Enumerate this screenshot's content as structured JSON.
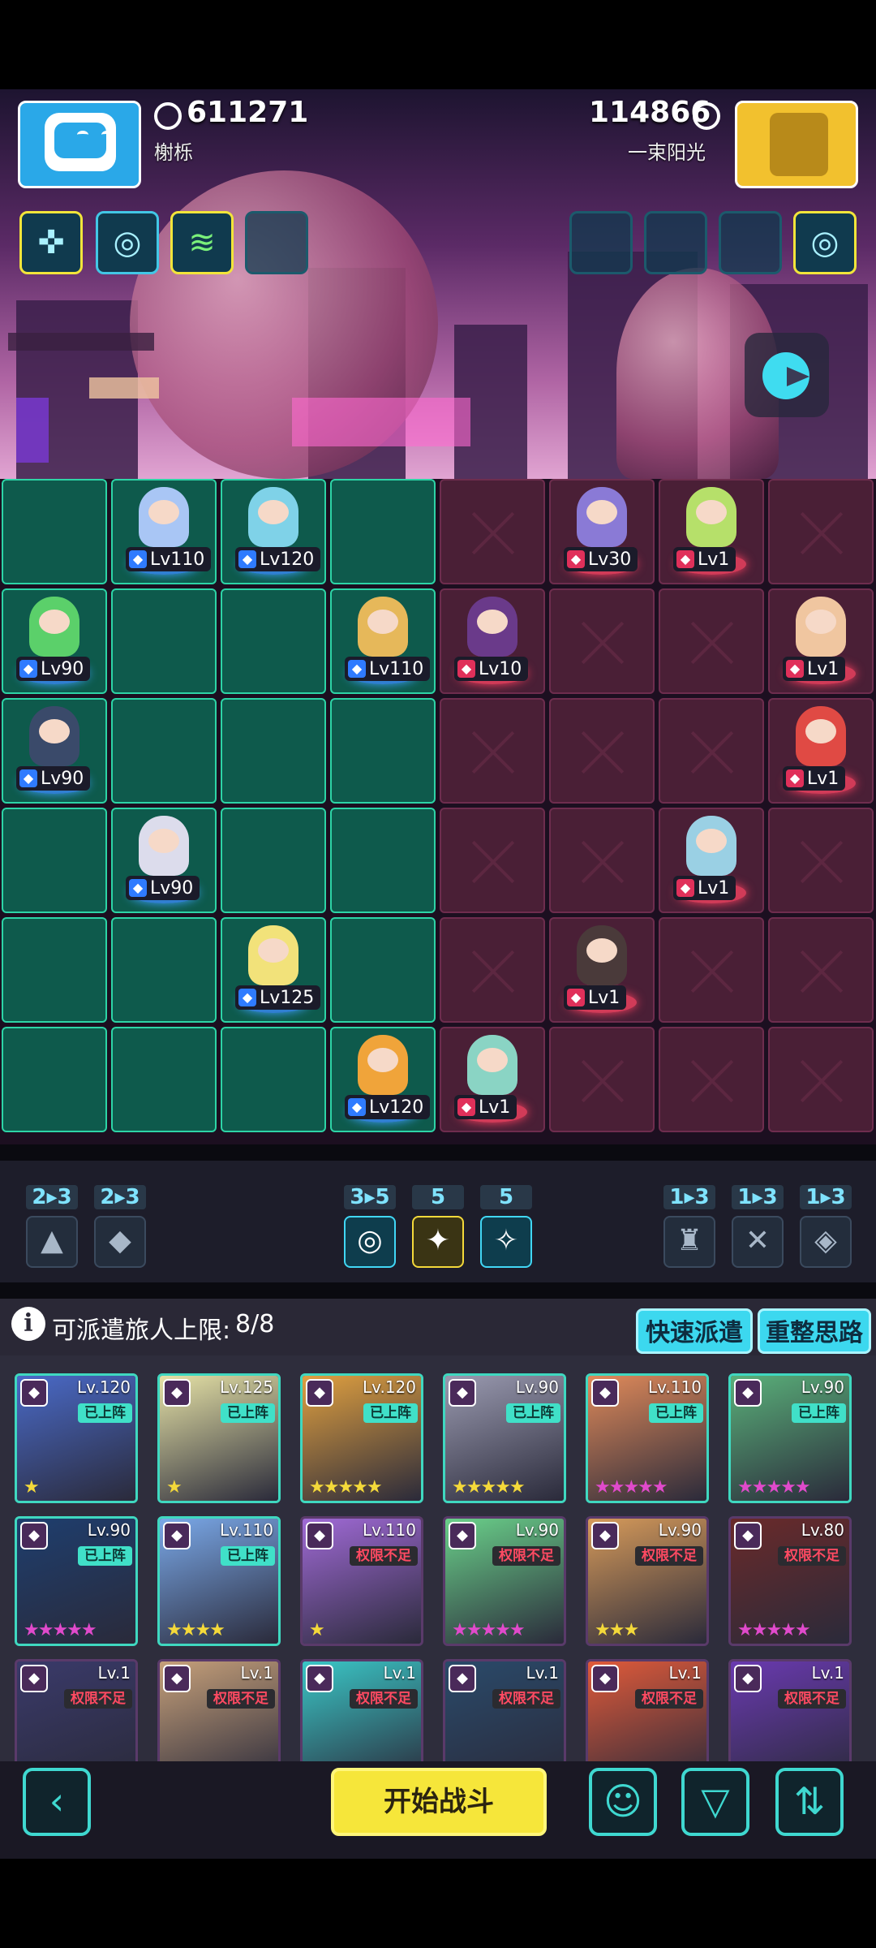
{
  "player": {
    "name": "榭栎",
    "score": "611271"
  },
  "opponent": {
    "name": "一束阳光",
    "score": "114866"
  },
  "player_slots": [
    "cross-rune-icon",
    "swirl-rune-icon",
    "zigzag-rune-icon",
    ""
  ],
  "opponent_slots": [
    "",
    "",
    "",
    "swirl-rune-icon"
  ],
  "board": {
    "allies": [
      {
        "lv": "Lv110",
        "col": 1,
        "row": 0,
        "color": "#a9c6f5"
      },
      {
        "lv": "Lv120",
        "col": 2,
        "row": 0,
        "color": "#7fd2e8"
      },
      {
        "lv": "Lv90",
        "col": 0,
        "row": 1,
        "color": "#5bd06a"
      },
      {
        "lv": "Lv110",
        "col": 3,
        "row": 1,
        "color": "#e6b85a"
      },
      {
        "lv": "Lv90",
        "col": 0,
        "row": 2,
        "color": "#3a4a6a"
      },
      {
        "lv": "Lv90",
        "col": 1,
        "row": 3,
        "color": "#dcdcec"
      },
      {
        "lv": "Lv125",
        "col": 2,
        "row": 4,
        "color": "#f2e27a"
      },
      {
        "lv": "Lv120",
        "col": 3,
        "row": 5,
        "color": "#f0a43a"
      }
    ],
    "enemies": [
      {
        "lv": "Lv30",
        "col": 5,
        "row": 0,
        "color": "#8a7ad6"
      },
      {
        "lv": "Lv1",
        "col": 6,
        "row": 0,
        "color": "#b6e06a"
      },
      {
        "lv": "Lv10",
        "col": 4,
        "row": 1,
        "color": "#6a3a8a"
      },
      {
        "lv": "Lv1",
        "col": 7,
        "row": 1,
        "color": "#f0c6a0"
      },
      {
        "lv": "Lv1",
        "col": 7,
        "row": 2,
        "color": "#e04a44"
      },
      {
        "lv": "Lv1",
        "col": 6,
        "row": 3,
        "color": "#9ad0e4"
      },
      {
        "lv": "Lv1",
        "col": 5,
        "row": 4,
        "color": "#4a3a3a"
      },
      {
        "lv": "Lv1",
        "col": 4,
        "row": 5,
        "color": "#8ad4c4"
      }
    ]
  },
  "synergies": [
    {
      "count": "2▸3",
      "icon": "▲",
      "state": "inactive"
    },
    {
      "count": "2▸3",
      "icon": "◆",
      "state": "inactive"
    },
    {
      "count": "3▸5",
      "icon": "◎",
      "state": "active"
    },
    {
      "count": "5",
      "icon": "✦",
      "state": "gold"
    },
    {
      "count": "5",
      "icon": "✧",
      "state": "active"
    },
    {
      "count": "1▸3",
      "icon": "♜",
      "state": "inactive"
    },
    {
      "count": "1▸3",
      "icon": "✕",
      "state": "inactive"
    },
    {
      "count": "1▸3",
      "icon": "◈",
      "state": "inactive"
    }
  ],
  "dispatch": {
    "label": "可派遣旅人上限:",
    "count": "8/8",
    "info": "i"
  },
  "buttons": {
    "quick": "快速派遣",
    "reset": "重整思路",
    "start": "开始战斗",
    "back": "‹",
    "brain": "☺",
    "filter": "▽",
    "sort": "⇅"
  },
  "roster": [
    {
      "lv": "Lv.120",
      "tag": "已上阵",
      "on": true,
      "stars": 1,
      "star_color": "#f4d93a",
      "color": "#4a6ac8"
    },
    {
      "lv": "Lv.125",
      "tag": "已上阵",
      "on": true,
      "stars": 1,
      "star_color": "#f4d93a",
      "color": "#e6e2a6"
    },
    {
      "lv": "Lv.120",
      "tag": "已上阵",
      "on": true,
      "stars": 5,
      "star_color": "#f4d93a",
      "color": "#e0a040"
    },
    {
      "lv": "Lv.90",
      "tag": "已上阵",
      "on": true,
      "stars": 5,
      "star_color": "#f4d93a",
      "color": "#9a9ab0"
    },
    {
      "lv": "Lv.110",
      "tag": "已上阵",
      "on": true,
      "stars": 5,
      "star_color": "#e04acb",
      "color": "#e08a5a"
    },
    {
      "lv": "Lv.90",
      "tag": "已上阵",
      "on": true,
      "stars": 5,
      "star_color": "#e04acb",
      "color": "#5ab07a"
    },
    {
      "lv": "Lv.90",
      "tag": "已上阵",
      "on": true,
      "stars": 5,
      "star_color": "#e04acb",
      "color": "#1e3e6e"
    },
    {
      "lv": "Lv.110",
      "tag": "已上阵",
      "on": true,
      "stars": 4,
      "star_color": "#f4d93a",
      "color": "#7aa8e8"
    },
    {
      "lv": "Lv.110",
      "tag": "权限不足",
      "on": false,
      "stars": 1,
      "star_color": "#f4d93a",
      "color": "#a06ad6"
    },
    {
      "lv": "Lv.90",
      "tag": "权限不足",
      "on": false,
      "stars": 5,
      "star_color": "#e04acb",
      "color": "#6ad08a"
    },
    {
      "lv": "Lv.90",
      "tag": "权限不足",
      "on": false,
      "stars": 3,
      "star_color": "#f4d93a",
      "color": "#d69a5a"
    },
    {
      "lv": "Lv.80",
      "tag": "权限不足",
      "on": false,
      "stars": 5,
      "star_color": "#e04acb",
      "color": "#6a2a2a"
    },
    {
      "lv": "Lv.1",
      "tag": "权限不足",
      "on": false,
      "stars": 0,
      "star_color": "#f4d93a",
      "color": "#3a3a6a"
    },
    {
      "lv": "Lv.1",
      "tag": "权限不足",
      "on": false,
      "stars": 0,
      "star_color": "#f4d93a",
      "color": "#c6a07a"
    },
    {
      "lv": "Lv.1",
      "tag": "权限不足",
      "on": false,
      "stars": 0,
      "star_color": "#f4d93a",
      "color": "#3ac6c6"
    },
    {
      "lv": "Lv.1",
      "tag": "权限不足",
      "on": false,
      "stars": 0,
      "star_color": "#f4d93a",
      "color": "#2a4a6a"
    },
    {
      "lv": "Lv.1",
      "tag": "权限不足",
      "on": false,
      "stars": 0,
      "star_color": "#f4d93a",
      "color": "#e05a3a"
    },
    {
      "lv": "Lv.1",
      "tag": "权限不足",
      "on": false,
      "stars": 0,
      "star_color": "#f4d93a",
      "color": "#6a3ab0"
    }
  ],
  "colors": {
    "ally_tile": "#0e5a4c",
    "enemy_tile": "#4a1f36",
    "accent": "#3cd8ef",
    "start": "#f6e63a"
  }
}
